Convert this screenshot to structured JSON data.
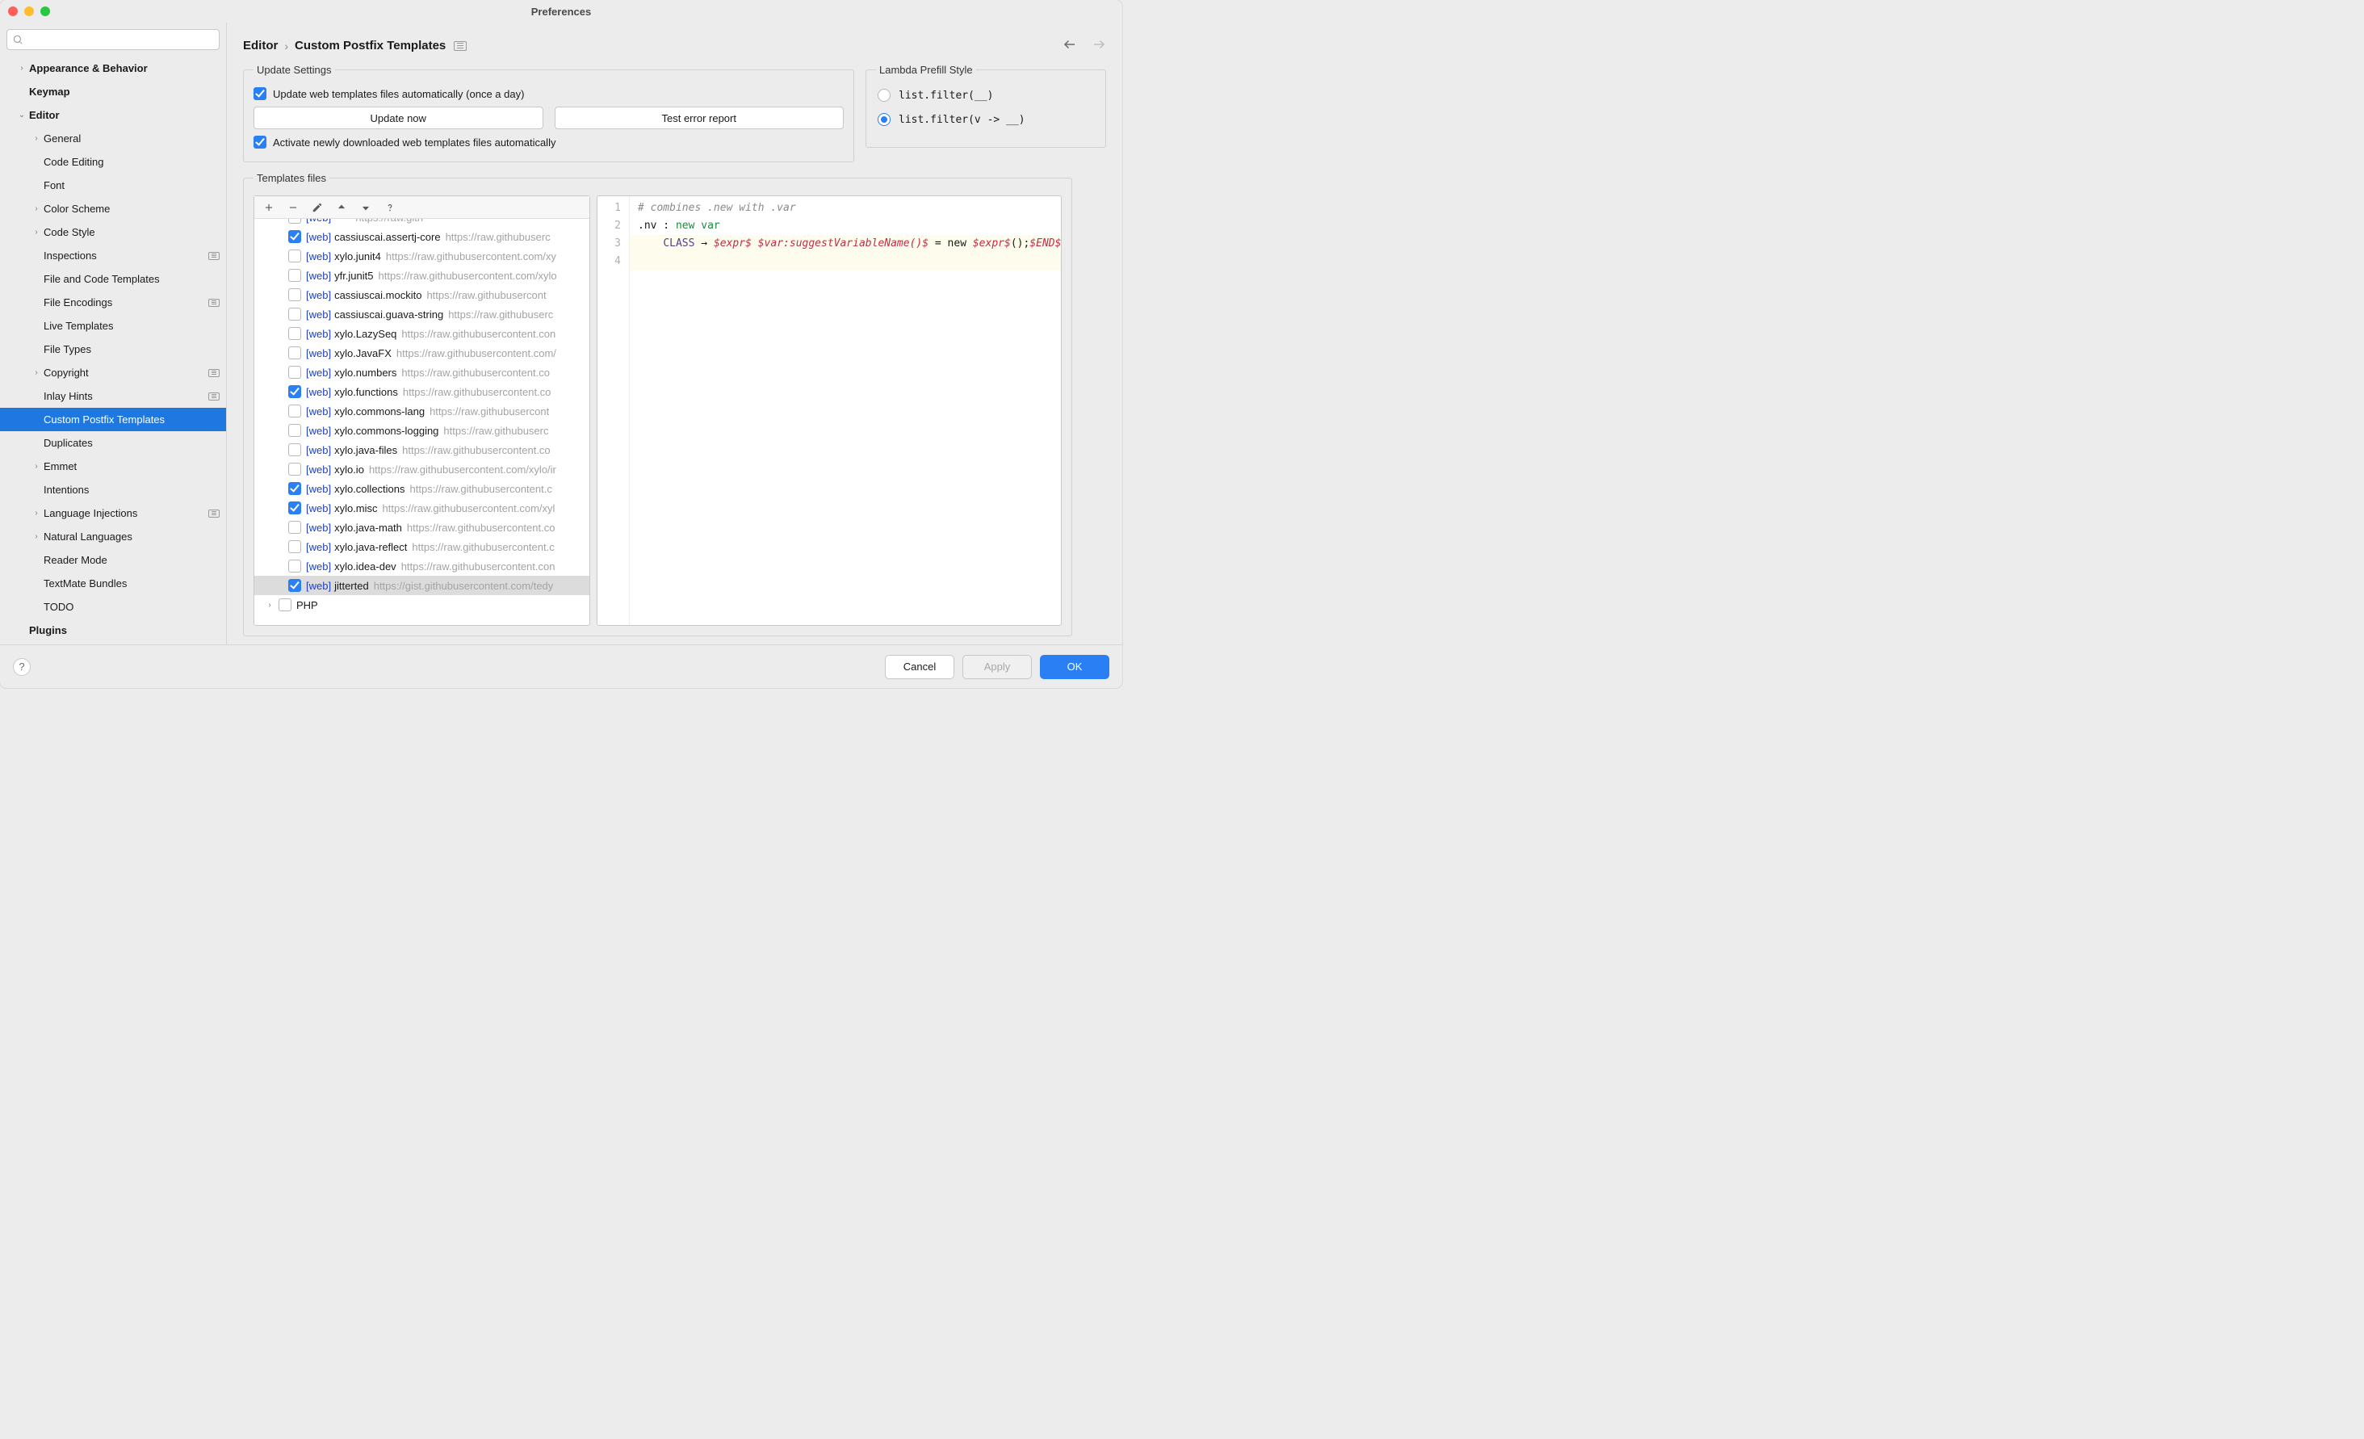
{
  "window": {
    "title": "Preferences"
  },
  "breadcrumb": {
    "parent": "Editor",
    "current": "Custom Postfix Templates"
  },
  "sidebar": {
    "search_placeholder": "",
    "items": [
      {
        "label": "Appearance & Behavior",
        "depth": 0,
        "chev": ">",
        "bold": true
      },
      {
        "label": "Keymap",
        "depth": 0,
        "chev": "",
        "bold": true
      },
      {
        "label": "Editor",
        "depth": 0,
        "chev": "v",
        "bold": true
      },
      {
        "label": "General",
        "depth": 1,
        "chev": ">"
      },
      {
        "label": "Code Editing",
        "depth": 1,
        "chev": ""
      },
      {
        "label": "Font",
        "depth": 1,
        "chev": ""
      },
      {
        "label": "Color Scheme",
        "depth": 1,
        "chev": ">"
      },
      {
        "label": "Code Style",
        "depth": 1,
        "chev": ">"
      },
      {
        "label": "Inspections",
        "depth": 1,
        "chev": "",
        "badge": true
      },
      {
        "label": "File and Code Templates",
        "depth": 1,
        "chev": ""
      },
      {
        "label": "File Encodings",
        "depth": 1,
        "chev": "",
        "badge": true
      },
      {
        "label": "Live Templates",
        "depth": 1,
        "chev": ""
      },
      {
        "label": "File Types",
        "depth": 1,
        "chev": ""
      },
      {
        "label": "Copyright",
        "depth": 1,
        "chev": ">",
        "badge": true
      },
      {
        "label": "Inlay Hints",
        "depth": 1,
        "chev": "",
        "badge": true
      },
      {
        "label": "Custom Postfix Templates",
        "depth": 1,
        "chev": "",
        "selected": true
      },
      {
        "label": "Duplicates",
        "depth": 1,
        "chev": ""
      },
      {
        "label": "Emmet",
        "depth": 1,
        "chev": ">"
      },
      {
        "label": "Intentions",
        "depth": 1,
        "chev": ""
      },
      {
        "label": "Language Injections",
        "depth": 1,
        "chev": ">",
        "badge": true
      },
      {
        "label": "Natural Languages",
        "depth": 1,
        "chev": ">"
      },
      {
        "label": "Reader Mode",
        "depth": 1,
        "chev": ""
      },
      {
        "label": "TextMate Bundles",
        "depth": 1,
        "chev": ""
      },
      {
        "label": "TODO",
        "depth": 1,
        "chev": ""
      },
      {
        "label": "Plugins",
        "depth": 0,
        "chev": "",
        "bold": true
      }
    ]
  },
  "update": {
    "legend": "Update Settings",
    "auto_label": "Update web templates files automatically (once a day)",
    "auto_checked": true,
    "now_btn": "Update now",
    "test_btn": "Test error report",
    "activate_label": "Activate newly downloaded web templates files automatically",
    "activate_checked": true
  },
  "lambda": {
    "legend": "Lambda Prefill Style",
    "opt1": "list.filter(__)",
    "opt2": "list.filter(v -> __)",
    "selected": 2
  },
  "templates": {
    "legend": "Templates files",
    "files": [
      {
        "checked": true,
        "tag": "[web]",
        "name": "cassiuscai.assertj-core",
        "url": "https://raw.githubuserc"
      },
      {
        "checked": false,
        "tag": "[web]",
        "name": "xylo.junit4",
        "url": "https://raw.githubusercontent.com/xy"
      },
      {
        "checked": false,
        "tag": "[web]",
        "name": "yfr.junit5",
        "url": "https://raw.githubusercontent.com/xylo"
      },
      {
        "checked": false,
        "tag": "[web]",
        "name": "cassiuscai.mockito",
        "url": "https://raw.githubusercont"
      },
      {
        "checked": false,
        "tag": "[web]",
        "name": "cassiuscai.guava-string",
        "url": "https://raw.githubuserc"
      },
      {
        "checked": false,
        "tag": "[web]",
        "name": "xylo.LazySeq",
        "url": "https://raw.githubusercontent.con"
      },
      {
        "checked": false,
        "tag": "[web]",
        "name": "xylo.JavaFX",
        "url": "https://raw.githubusercontent.com/"
      },
      {
        "checked": false,
        "tag": "[web]",
        "name": "xylo.numbers",
        "url": "https://raw.githubusercontent.co"
      },
      {
        "checked": true,
        "tag": "[web]",
        "name": "xylo.functions",
        "url": "https://raw.githubusercontent.co"
      },
      {
        "checked": false,
        "tag": "[web]",
        "name": "xylo.commons-lang",
        "url": "https://raw.githubusercont"
      },
      {
        "checked": false,
        "tag": "[web]",
        "name": "xylo.commons-logging",
        "url": "https://raw.githubuserc"
      },
      {
        "checked": false,
        "tag": "[web]",
        "name": "xylo.java-files",
        "url": "https://raw.githubusercontent.co"
      },
      {
        "checked": false,
        "tag": "[web]",
        "name": "xylo.io",
        "url": "https://raw.githubusercontent.com/xylo/ir"
      },
      {
        "checked": true,
        "tag": "[web]",
        "name": "xylo.collections",
        "url": "https://raw.githubusercontent.c"
      },
      {
        "checked": true,
        "tag": "[web]",
        "name": "xylo.misc",
        "url": "https://raw.githubusercontent.com/xyl"
      },
      {
        "checked": false,
        "tag": "[web]",
        "name": "xylo.java-math",
        "url": "https://raw.githubusercontent.co"
      },
      {
        "checked": false,
        "tag": "[web]",
        "name": "xylo.java-reflect",
        "url": "https://raw.githubusercontent.c"
      },
      {
        "checked": false,
        "tag": "[web]",
        "name": "xylo.idea-dev",
        "url": "https://raw.githubusercontent.con"
      },
      {
        "checked": true,
        "tag": "[web]",
        "name": "jitterted",
        "url": "https://gist.githubusercontent.com/tedy",
        "selected": true
      }
    ],
    "group": {
      "label": "PHP",
      "checked": false
    }
  },
  "editor": {
    "lines": [
      {
        "n": "1",
        "segments": [
          {
            "t": "# combines .new with .var",
            "c": "c-comment"
          }
        ]
      },
      {
        "n": "2",
        "segments": [
          {
            "t": ".nv : ",
            "c": "c-plain"
          },
          {
            "t": "new var",
            "c": "c-key"
          }
        ]
      },
      {
        "n": "3",
        "hl": true,
        "segments": [
          {
            "t": "    ",
            "c": "c-plain"
          },
          {
            "t": "CLASS",
            "c": "c-tok"
          },
          {
            "t": " → ",
            "c": "c-plain"
          },
          {
            "t": "$expr$",
            "c": "c-var"
          },
          {
            "t": " ",
            "c": "c-plain"
          },
          {
            "t": "$var:suggestVariableName()$",
            "c": "c-var"
          },
          {
            "t": " = new ",
            "c": "c-plain"
          },
          {
            "t": "$expr$",
            "c": "c-var"
          },
          {
            "t": "();",
            "c": "c-plain"
          },
          {
            "t": "$END$",
            "c": "c-var"
          }
        ]
      },
      {
        "n": "4",
        "hl": true,
        "segments": []
      }
    ]
  },
  "footer": {
    "cancel": "Cancel",
    "apply": "Apply",
    "ok": "OK"
  }
}
